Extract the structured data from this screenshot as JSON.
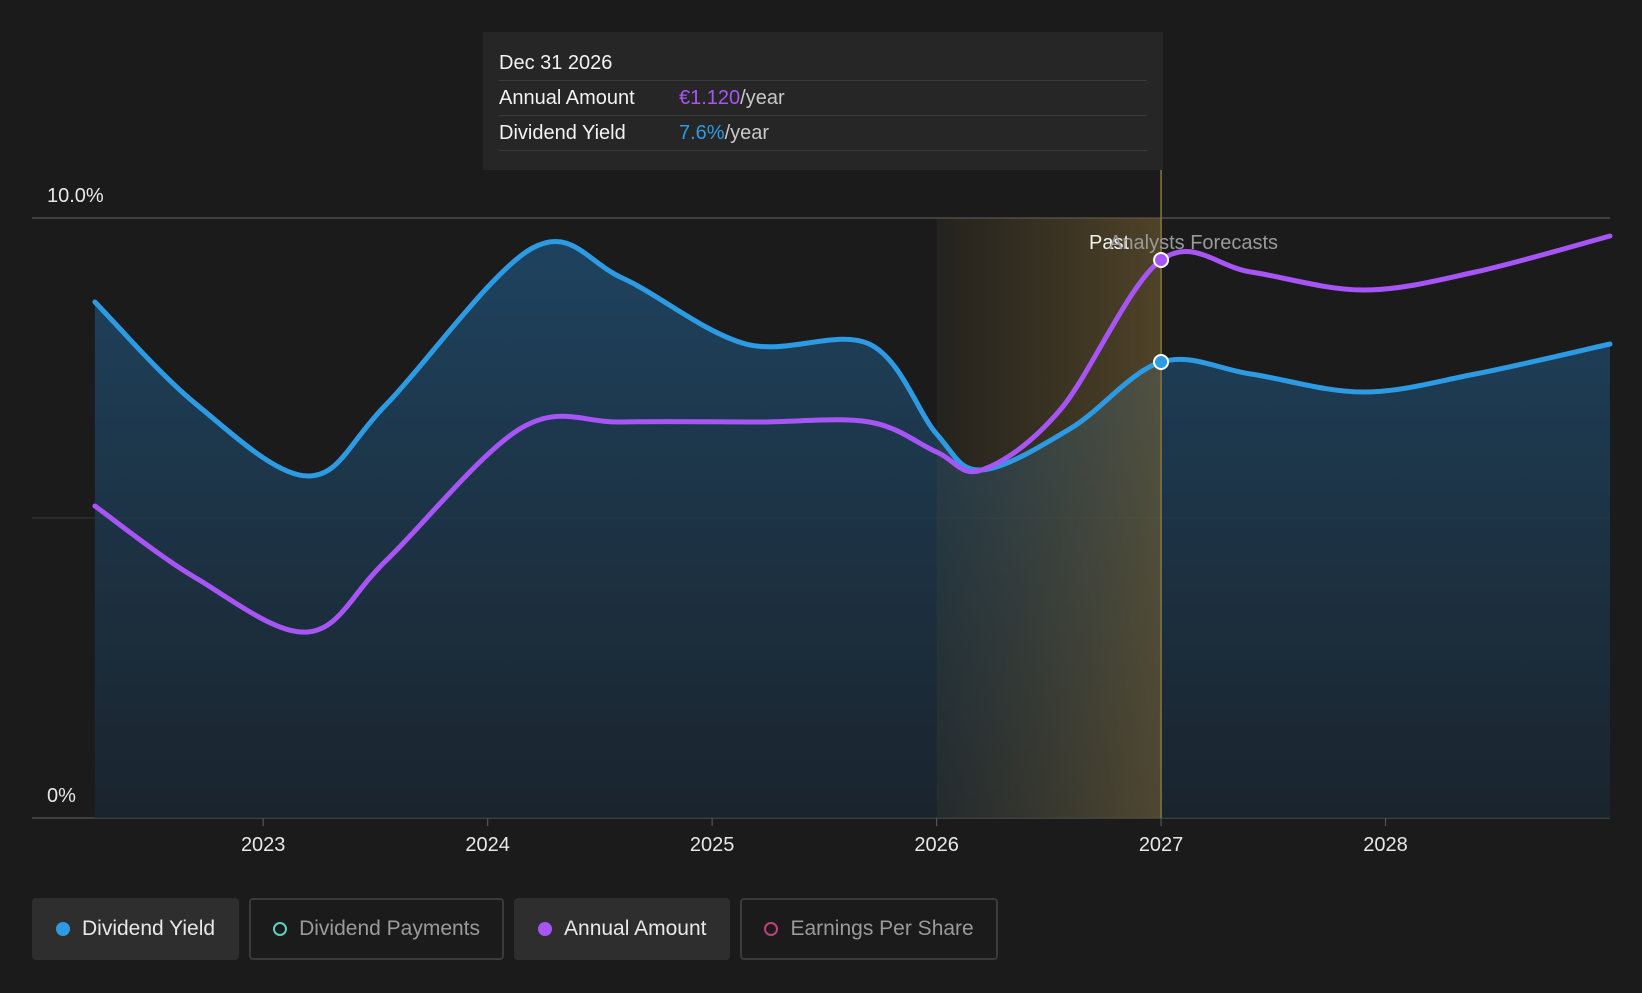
{
  "tooltip": {
    "date": "Dec 31 2026",
    "rows": [
      {
        "label": "Annual Amount",
        "value": "€1.120",
        "unit": "/year",
        "color": "#a855f7"
      },
      {
        "label": "Dividend Yield",
        "value": "7.6%",
        "unit": "/year",
        "color": "#2d9be3"
      }
    ]
  },
  "legend": [
    {
      "label": "Dividend Yield",
      "color": "#2d9be3",
      "active": true,
      "filled": true
    },
    {
      "label": "Dividend Payments",
      "color": "#5fd0bf",
      "active": false,
      "filled": false
    },
    {
      "label": "Annual Amount",
      "color": "#a855f7",
      "active": true,
      "filled": true
    },
    {
      "label": "Earnings Per Share",
      "color": "#c0407a",
      "active": false,
      "filled": false
    }
  ],
  "chart_data": {
    "type": "line",
    "y_tick_labels": [
      "10.0%",
      "0%"
    ],
    "ylim": [
      0,
      10
    ],
    "x_tick_labels": [
      "2023",
      "2024",
      "2025",
      "2026",
      "2027",
      "2028"
    ],
    "x_ticks": [
      2023,
      2024,
      2025,
      2026,
      2027,
      2028
    ],
    "xlim": [
      2021.97,
      2029.0
    ],
    "grid": true,
    "region_labels": {
      "past": "Past",
      "forecast": "Analysts Forecasts"
    },
    "past_region": [
      2026.0,
      2027.0
    ],
    "forecast_start": 2027.0,
    "highlight_x": 2027.0,
    "series": [
      {
        "name": "Dividend Yield",
        "color": "#2d9be3",
        "area": true,
        "points": [
          [
            2022.25,
            8.6
          ],
          [
            2022.7,
            6.9
          ],
          [
            2023.2,
            5.7
          ],
          [
            2023.55,
            6.9
          ],
          [
            2024.2,
            9.5
          ],
          [
            2024.6,
            9.0
          ],
          [
            2025.15,
            7.9
          ],
          [
            2025.7,
            7.9
          ],
          [
            2026.0,
            6.4
          ],
          [
            2026.2,
            5.8
          ],
          [
            2026.6,
            6.5
          ],
          [
            2027.0,
            7.6
          ],
          [
            2027.4,
            7.4
          ],
          [
            2027.9,
            7.1
          ],
          [
            2028.4,
            7.4
          ],
          [
            2029.0,
            7.9
          ]
        ]
      },
      {
        "name": "Annual Amount",
        "color": "#a855f7",
        "area": false,
        "points": [
          [
            2022.25,
            5.2
          ],
          [
            2022.7,
            4.0
          ],
          [
            2023.2,
            3.1
          ],
          [
            2023.55,
            4.3
          ],
          [
            2024.15,
            6.5
          ],
          [
            2024.6,
            6.6
          ],
          [
            2025.2,
            6.6
          ],
          [
            2025.7,
            6.6
          ],
          [
            2026.0,
            6.1
          ],
          [
            2026.2,
            5.8
          ],
          [
            2026.55,
            6.8
          ],
          [
            2027.0,
            9.3
          ],
          [
            2027.4,
            9.1
          ],
          [
            2027.9,
            8.8
          ],
          [
            2028.4,
            9.1
          ],
          [
            2029.0,
            9.7
          ]
        ]
      }
    ]
  }
}
